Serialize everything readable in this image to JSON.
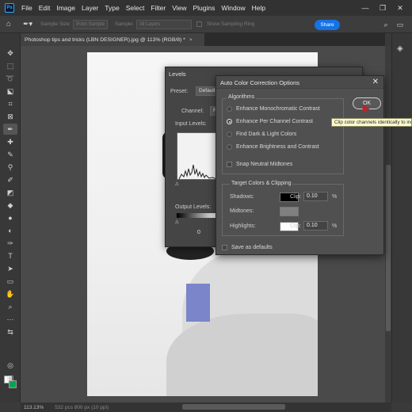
{
  "app": {
    "logo": "Ps",
    "menu": [
      "File",
      "Edit",
      "Image",
      "Layer",
      "Type",
      "Select",
      "Filter",
      "View",
      "Plugins",
      "Window",
      "Help"
    ],
    "window_controls": [
      "—",
      "❐",
      "✕"
    ]
  },
  "options_bar": {
    "sample_size_label": "Sample Size:",
    "sample_size_value": "Point Sample",
    "sample_label": "Sample:",
    "sample_value": "All Layers",
    "show_ring_label": "Show Sampling Ring",
    "share_label": "Share"
  },
  "document_tab": {
    "title": "Photoshop tips and tricks (LBN DESIGNER).jpg @ 113% (RGB/8) *",
    "close": "×"
  },
  "status_bar": {
    "zoom": "113.13%",
    "doc_info": "532 pcs 800 px (10 ppi)"
  },
  "levels": {
    "title": "Levels",
    "preset_label": "Preset:",
    "preset_value": "Default",
    "channel_label": "Channel:",
    "channel_value": "RGB",
    "input_levels_label": "Input Levels:",
    "output_levels_label": "Output Levels:",
    "output_low": "0"
  },
  "auto_color": {
    "title": "Auto Color Correction Options",
    "close": "✕",
    "algorithms_legend": "Algorithms",
    "algorithms": [
      {
        "label": "Enhance Monochromatic Contrast",
        "selected": false
      },
      {
        "label": "Enhance Per Channel Contrast",
        "selected": true
      },
      {
        "label": "Find Dark & Light Colors",
        "selected": false
      },
      {
        "label": "Enhance Brightness and Contrast",
        "selected": false
      }
    ],
    "snap_neutral_label": "Snap Neutral Midtones",
    "target_legend": "Target Colors & Clipping",
    "shadows_label": "Shadows:",
    "midtones_label": "Midtones:",
    "highlights_label": "Highlights:",
    "clip_label": "Clip:",
    "shadows_clip": "0.10",
    "highlights_clip": "0.10",
    "percent": "%",
    "shadows_color": "#000000",
    "midtones_color": "#808080",
    "highlights_color": "#ffffff",
    "save_defaults_label": "Save as defaults",
    "ok_label": "OK"
  },
  "tooltip": "Clip color channels identically to increase contrast"
}
